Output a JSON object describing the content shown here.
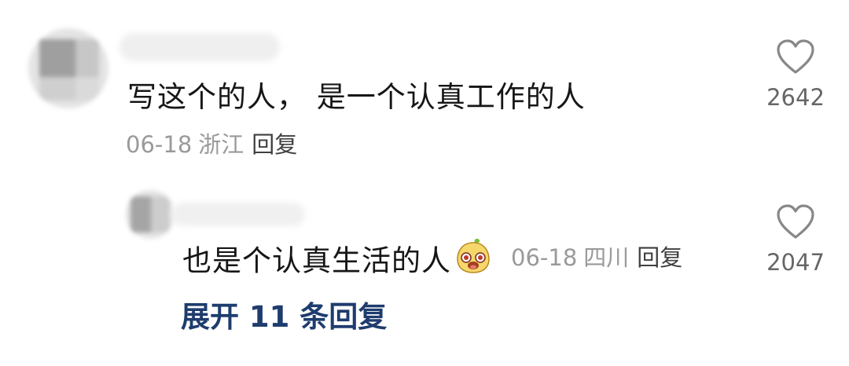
{
  "comments": [
    {
      "text": "写这个的人， 是一个认真工作的人",
      "date": "06-18",
      "location": "浙江",
      "reply_label": "回复",
      "likes": "2642",
      "icons": {
        "like": "heart-outline-icon"
      }
    },
    {
      "text": "也是个认真生活的人",
      "emoji": "smiling-face-emoji",
      "date": "06-18",
      "location": "四川",
      "reply_label": "回复",
      "likes": "2047",
      "icons": {
        "like": "heart-outline-icon"
      }
    }
  ],
  "expand_replies_label": "展开 11 条回复",
  "colors": {
    "text": "#161616",
    "meta": "#9a9a9a",
    "reply": "#3f3f3f",
    "expand": "#1e3c6e",
    "heart": "#888888"
  }
}
